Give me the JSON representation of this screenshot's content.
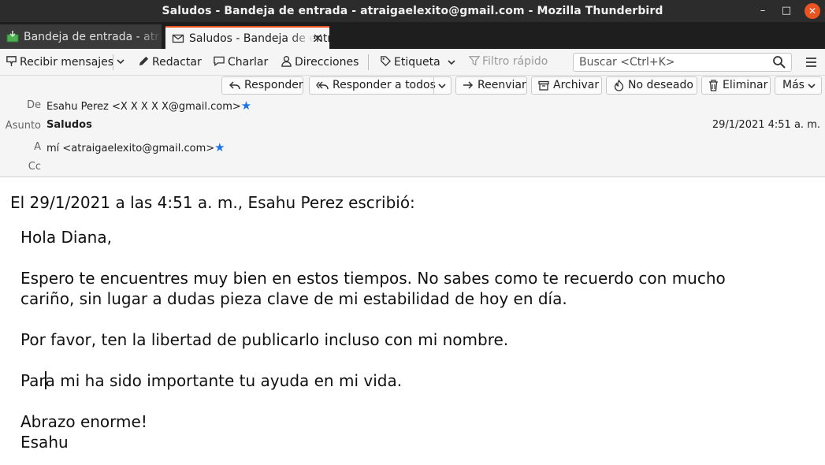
{
  "window": {
    "title": "Saludos - Bandeja de entrada - atraigaelexito@gmail.com - Mozilla Thunderbird",
    "minimize": "–",
    "maximize": "□",
    "close": "✕"
  },
  "tabs": [
    {
      "label": "Bandeja de entrada - atraigaelexito@gmail.com",
      "icon": "inbox-icon"
    },
    {
      "label": "Saludos - Bandeja de entrada",
      "icon": "envelope-icon",
      "close": "✕"
    }
  ],
  "toolbar": {
    "get_messages": "Recibir mensajes",
    "write": "Redactar",
    "chat": "Charlar",
    "address_book": "Direcciones",
    "tag": "Etiqueta",
    "quick_filter": "Filtro rápido",
    "search_placeholder": "Buscar <Ctrl+K>"
  },
  "header_buttons": {
    "reply": "Responder",
    "reply_all": "Responder a todos",
    "forward": "Reenviar",
    "archive": "Archivar",
    "junk": "No deseado",
    "delete": "Eliminar",
    "more": "Más"
  },
  "header": {
    "from_label": "De",
    "from_value": "Esahu Perez <X X X X X@gmail.com>",
    "subject_label": "Asunto",
    "subject_value": "Saludos",
    "date": "29/1/2021 4:51 a. m.",
    "to_label": "A",
    "to_value": "mí <atraigaelexito@gmail.com>",
    "cc_label": "Cc"
  },
  "body": {
    "citation": "El 29/1/2021 a las 4:51 a. m., Esahu Perez escribió:",
    "greeting": "Hola Diana,",
    "para1_line1": "Espero te encuentres muy bien en estos tiempos. No sabes como te recuerdo con mucho",
    "para1_line2": "cariño, sin lugar a dudas pieza clave de mi estabilidad de hoy en día.",
    "para2": "Por favor, ten la libertad de publicarlo incluso con mi nombre.",
    "para3_before_caret": "Par",
    "para3_after_caret": "a mi ha sido importante tu ayuda en mi vida.",
    "closing": "Abrazo enorme!",
    "signature": "Esahu"
  },
  "colors": {
    "accent": "#e95420",
    "star": "#1a73e8",
    "titlebar": "#2c2c2c"
  }
}
